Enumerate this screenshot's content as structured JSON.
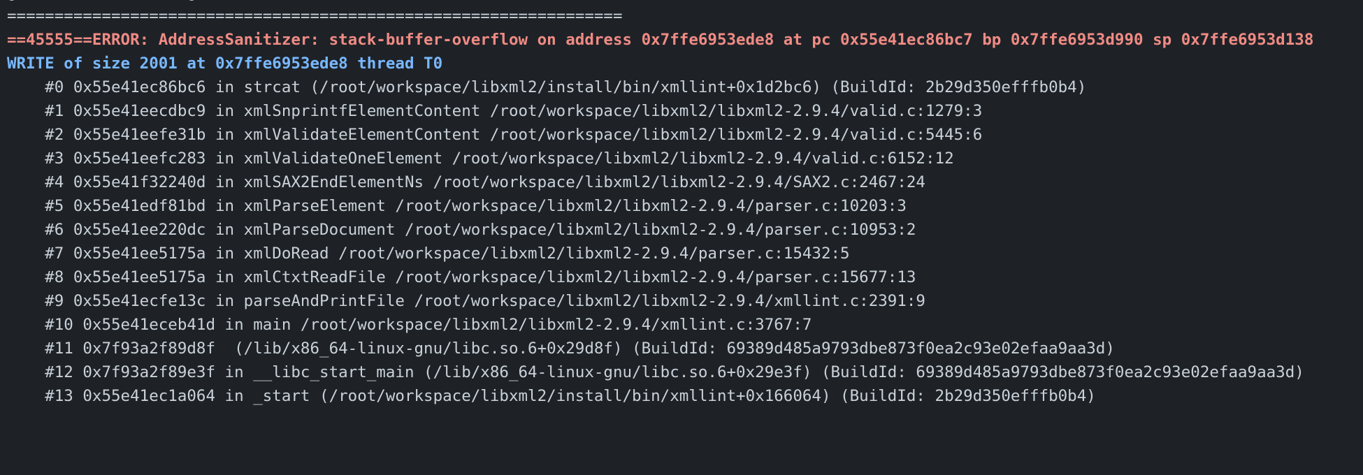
{
  "terminal": {
    "cut_line": "●                  ●",
    "separator": "=================================================================",
    "error_line": "==45555==ERROR: AddressSanitizer: stack-buffer-overflow on address 0x7ffe6953ede8 at pc 0x55e41ec86bc7 bp 0x7ffe6953d990 sp 0x7ffe6953d138",
    "write_line": "WRITE of size 2001 at 0x7ffe6953ede8 thread T0",
    "frames": [
      "    #0 0x55e41ec86bc6 in strcat (/root/workspace/libxml2/install/bin/xmllint+0x1d2bc6) (BuildId: 2b29d350efffb0b4)",
      "    #1 0x55e41eecdbc9 in xmlSnprintfElementContent /root/workspace/libxml2/libxml2-2.9.4/valid.c:1279:3",
      "    #2 0x55e41eefe31b in xmlValidateElementContent /root/workspace/libxml2/libxml2-2.9.4/valid.c:5445:6",
      "    #3 0x55e41eefc283 in xmlValidateOneElement /root/workspace/libxml2/libxml2-2.9.4/valid.c:6152:12",
      "    #4 0x55e41f32240d in xmlSAX2EndElementNs /root/workspace/libxml2/libxml2-2.9.4/SAX2.c:2467:24",
      "    #5 0x55e41edf81bd in xmlParseElement /root/workspace/libxml2/libxml2-2.9.4/parser.c:10203:3",
      "    #6 0x55e41ee220dc in xmlParseDocument /root/workspace/libxml2/libxml2-2.9.4/parser.c:10953:2",
      "    #7 0x55e41ee5175a in xmlDoRead /root/workspace/libxml2/libxml2-2.9.4/parser.c:15432:5",
      "    #8 0x55e41ee5175a in xmlCtxtReadFile /root/workspace/libxml2/libxml2-2.9.4/parser.c:15677:13",
      "    #9 0x55e41ecfe13c in parseAndPrintFile /root/workspace/libxml2/libxml2-2.9.4/xmllint.c:2391:9",
      "    #10 0x55e41eceb41d in main /root/workspace/libxml2/libxml2-2.9.4/xmllint.c:3767:7",
      "    #11 0x7f93a2f89d8f  (/lib/x86_64-linux-gnu/libc.so.6+0x29d8f) (BuildId: 69389d485a9793dbe873f0ea2c93e02efaa9aa3d)",
      "    #12 0x7f93a2f89e3f in __libc_start_main (/lib/x86_64-linux-gnu/libc.so.6+0x29e3f) (BuildId: 69389d485a9793dbe873f0ea2c93e02efaa9aa3d)",
      "    #13 0x55e41ec1a064 in _start (/root/workspace/libxml2/install/bin/xmllint+0x166064) (BuildId: 2b29d350efffb0b4)"
    ]
  },
  "colors": {
    "background": "#1e2227",
    "text": "#c9d1d9",
    "error": "#f08b84",
    "write": "#79b8ff"
  }
}
